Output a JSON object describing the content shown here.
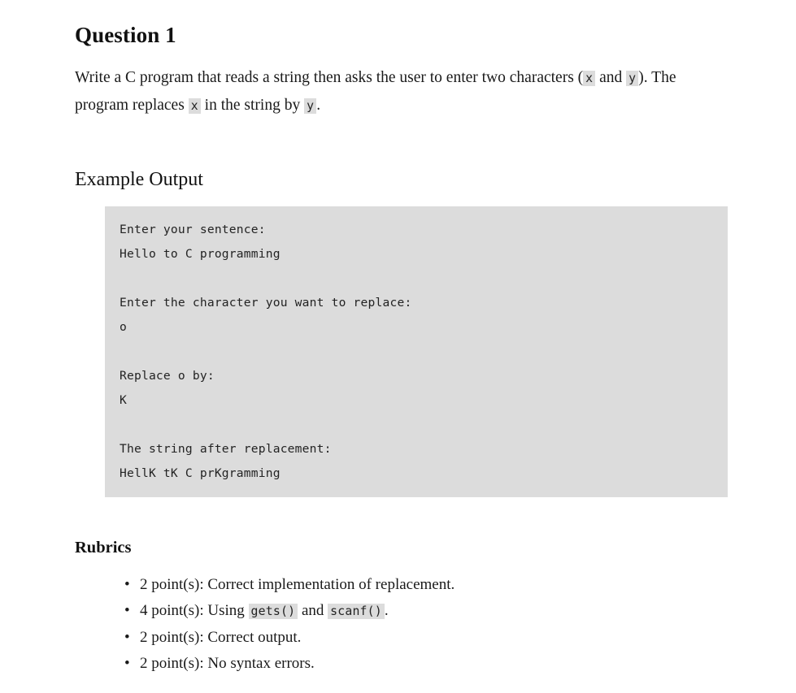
{
  "question": {
    "title": "Question 1",
    "prompt": {
      "part1": "Write a C program that reads a string then asks the user to enter two characters (",
      "code_x1": "x",
      "part2": " and ",
      "code_y1": "y",
      "part3": "). The program replaces ",
      "code_x2": "x",
      "part4": " in the string by ",
      "code_y2": "y",
      "part5": "."
    }
  },
  "example": {
    "heading": "Example Output",
    "lines": [
      "Enter your sentence:",
      "Hello to C programming",
      "",
      "Enter the character you want to replace:",
      "o",
      "",
      "Replace o by:",
      "K",
      "",
      "The string after replacement:",
      "HellK tK C prKgramming"
    ]
  },
  "rubrics": {
    "heading": "Rubrics",
    "items": [
      {
        "text_before": "2 point(s): Correct implementation of replacement.",
        "code1": "",
        "text_mid": "",
        "code2": "",
        "text_after": ""
      },
      {
        "text_before": "4 point(s): Using ",
        "code1": "gets()",
        "text_mid": " and ",
        "code2": "scanf()",
        "text_after": "."
      },
      {
        "text_before": "2 point(s): Correct output.",
        "code1": "",
        "text_mid": "",
        "code2": "",
        "text_after": ""
      },
      {
        "text_before": "2 point(s): No syntax errors.",
        "code1": "",
        "text_mid": "",
        "code2": "",
        "text_after": ""
      }
    ]
  },
  "colors": {
    "page_background": "#ffffff",
    "text": "#1a1a1a",
    "code_background": "#dcdcdc",
    "code_text": "#232323"
  }
}
